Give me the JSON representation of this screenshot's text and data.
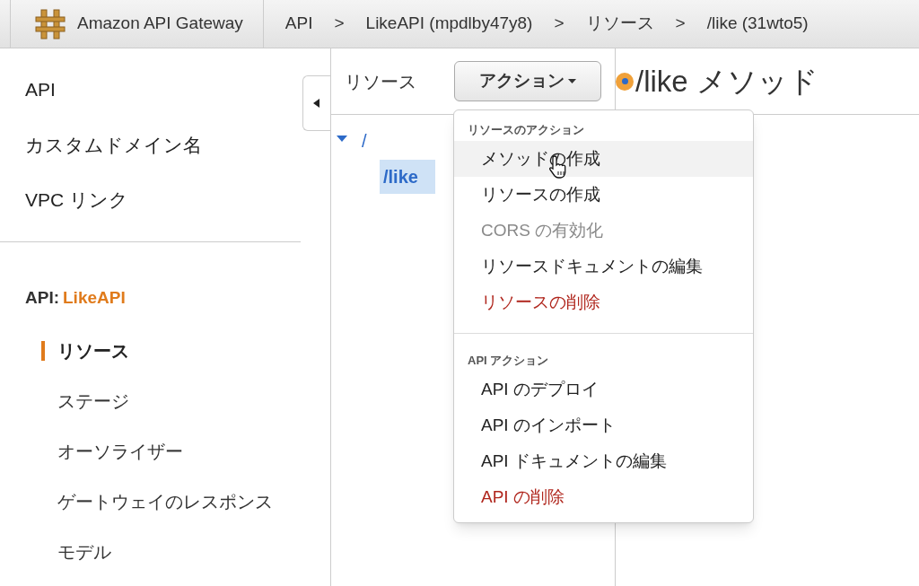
{
  "header": {
    "product": "Amazon API Gateway",
    "breadcrumbs": [
      "API",
      ">",
      "LikeAPI (mpdlby47y8)",
      ">",
      "リソース",
      ">",
      "/like (31wto5)"
    ]
  },
  "sidebar": {
    "top_items": [
      "API",
      "カスタムドメイン名",
      "VPC リンク"
    ],
    "api_label": "API:",
    "api_name": "LikeAPI",
    "nav_items": [
      {
        "label": "リソース",
        "selected": true
      },
      {
        "label": "ステージ",
        "selected": false
      },
      {
        "label": "オーソライザー",
        "selected": false
      },
      {
        "label": "ゲートウェイのレスポンス",
        "selected": false
      },
      {
        "label": "モデル",
        "selected": false
      }
    ]
  },
  "resources_panel": {
    "title": "リソース",
    "actions_button": "アクション",
    "tree": [
      {
        "label": "/",
        "expanded": true,
        "selected": false,
        "children": [
          {
            "label": "/like",
            "selected": true
          }
        ]
      }
    ]
  },
  "actions_menu": {
    "sections": [
      {
        "header": "リソースのアクション",
        "items": [
          {
            "label": "メソッドの作成",
            "kind": "normal",
            "hovered": true
          },
          {
            "label": "リソースの作成",
            "kind": "normal",
            "hovered": false
          },
          {
            "label": "CORS の有効化",
            "kind": "disabled",
            "hovered": false
          },
          {
            "label": "リソースドキュメントの編集",
            "kind": "normal",
            "hovered": false
          },
          {
            "label": "リソースの削除",
            "kind": "danger",
            "hovered": false
          }
        ]
      },
      {
        "header": "API アクション",
        "items": [
          {
            "label": "API のデプロイ",
            "kind": "normal",
            "hovered": false
          },
          {
            "label": "API のインポート",
            "kind": "normal",
            "hovered": false
          },
          {
            "label": "API ドキュメントの編集",
            "kind": "normal",
            "hovered": false
          },
          {
            "label": "API の削除",
            "kind": "danger",
            "hovered": false
          }
        ]
      }
    ]
  },
  "detail": {
    "title": "/like メソッド"
  }
}
